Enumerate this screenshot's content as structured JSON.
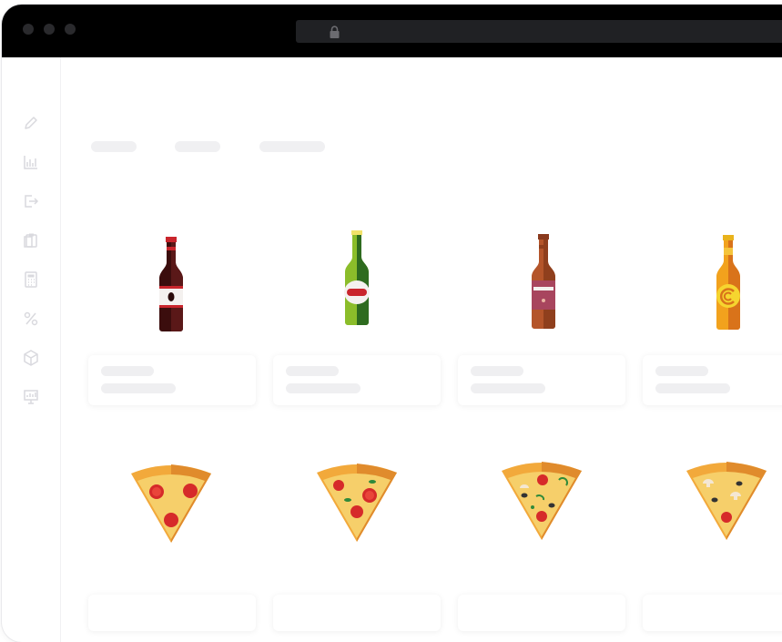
{
  "browser": {
    "address_bar_icon": "lock-icon"
  },
  "sidebar": {
    "items": [
      {
        "icon": "pencil-icon"
      },
      {
        "icon": "bar-chart-icon"
      },
      {
        "icon": "logout-icon"
      },
      {
        "icon": "clipboard-icon"
      },
      {
        "icon": "calculator-icon"
      },
      {
        "icon": "percent-icon"
      },
      {
        "icon": "box-icon"
      },
      {
        "icon": "presentation-icon"
      }
    ]
  },
  "products": {
    "drinks": [
      {
        "icon": "dark-cola-bottle-icon"
      },
      {
        "icon": "green-beer-bottle-icon"
      },
      {
        "icon": "brown-ale-bottle-icon"
      },
      {
        "icon": "amber-beer-bottle-icon"
      }
    ],
    "pizzas": [
      {
        "icon": "pepperoni-pizza-slice-icon"
      },
      {
        "icon": "margherita-pizza-slice-icon"
      },
      {
        "icon": "mixed-pizza-slice-icon"
      },
      {
        "icon": "mushroom-pizza-slice-icon"
      }
    ]
  },
  "colors": {
    "titlebar": "#000000",
    "urlbar": "#202124",
    "skeleton": "#efeff1",
    "sidebar_icon": "#d9d9de"
  }
}
